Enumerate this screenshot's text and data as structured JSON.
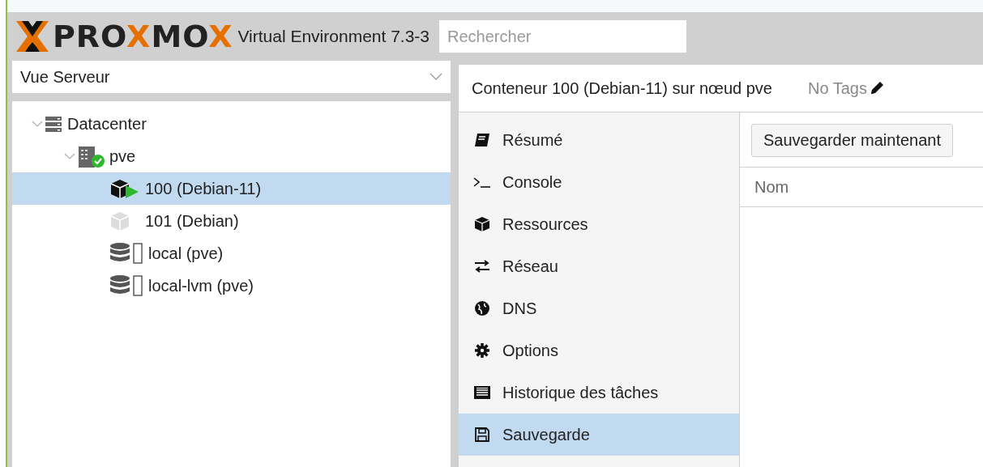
{
  "header": {
    "logo": [
      {
        "text": "PRO",
        "accent": false
      },
      {
        "text": "X",
        "accent": true
      },
      {
        "text": "MO",
        "accent": false
      },
      {
        "text": "X",
        "accent": true
      }
    ],
    "product": "Virtual Environment 7.3-3",
    "search": {
      "placeholder": "Rechercher"
    }
  },
  "view_selector": {
    "value": "Vue Serveur"
  },
  "tree": [
    {
      "kind": "datacenter",
      "label": "Datacenter",
      "expanded": true,
      "selected": false,
      "children": [
        {
          "kind": "node",
          "label": "pve",
          "expanded": true,
          "selected": false,
          "children": [
            {
              "kind": "container-running",
              "label": "100 (Debian-11)",
              "selected": true
            },
            {
              "kind": "container-stopped",
              "label": "101 (Debian)",
              "selected": false
            },
            {
              "kind": "storage",
              "label": "local (pve)",
              "selected": false
            },
            {
              "kind": "storage",
              "label": "local-lvm (pve)",
              "selected": false
            }
          ]
        }
      ]
    }
  ],
  "panel": {
    "title": "Conteneur 100 (Debian-11) sur nœud pve",
    "tags": "No Tags"
  },
  "nav": [
    {
      "kind": "summary",
      "label": "Résumé",
      "selected": false
    },
    {
      "kind": "console",
      "label": "Console",
      "selected": false
    },
    {
      "kind": "resources",
      "label": "Ressources",
      "selected": false
    },
    {
      "kind": "network",
      "label": "Réseau",
      "selected": false
    },
    {
      "kind": "dns",
      "label": "DNS",
      "selected": false
    },
    {
      "kind": "options",
      "label": "Options",
      "selected": false
    },
    {
      "kind": "tasks",
      "label": "Historique des tâches",
      "selected": false
    },
    {
      "kind": "backup",
      "label": "Sauvegarde",
      "selected": true
    }
  ],
  "toolbar": {
    "buttons": [
      "Sauvegarder maintenant"
    ]
  },
  "table": {
    "columns": [
      "Nom"
    ]
  }
}
